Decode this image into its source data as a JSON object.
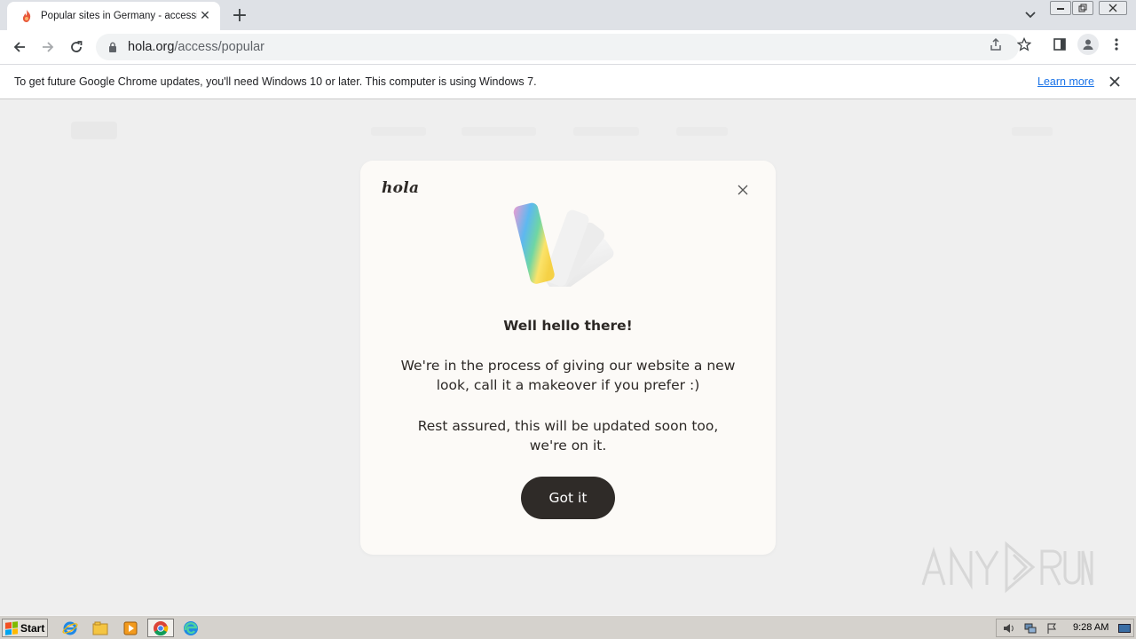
{
  "browser": {
    "tab": {
      "title": "Popular sites in Germany - accessible"
    },
    "omnibox": {
      "url_host": "hola.org",
      "url_path": "/access/popular"
    }
  },
  "infobar": {
    "message": "To get future Google Chrome updates, you'll need Windows 10 or later. This computer is using Windows 7.",
    "learn_more": "Learn more"
  },
  "modal": {
    "logo": "hola",
    "heading": "Well hello there!",
    "paragraph1": "We're in the process of giving our website a new look, call it a makeover if you prefer :)",
    "paragraph2": "Rest assured, this will be updated soon too, we're on it.",
    "button": "Got it"
  },
  "watermark": {
    "text": "ANY.RUN"
  },
  "taskbar": {
    "start": "Start",
    "clock": "9:28 AM"
  },
  "colors": {
    "modal_bg": "#fcfaf7",
    "button_bg": "#2f2b28",
    "link": "#1a73e8"
  }
}
